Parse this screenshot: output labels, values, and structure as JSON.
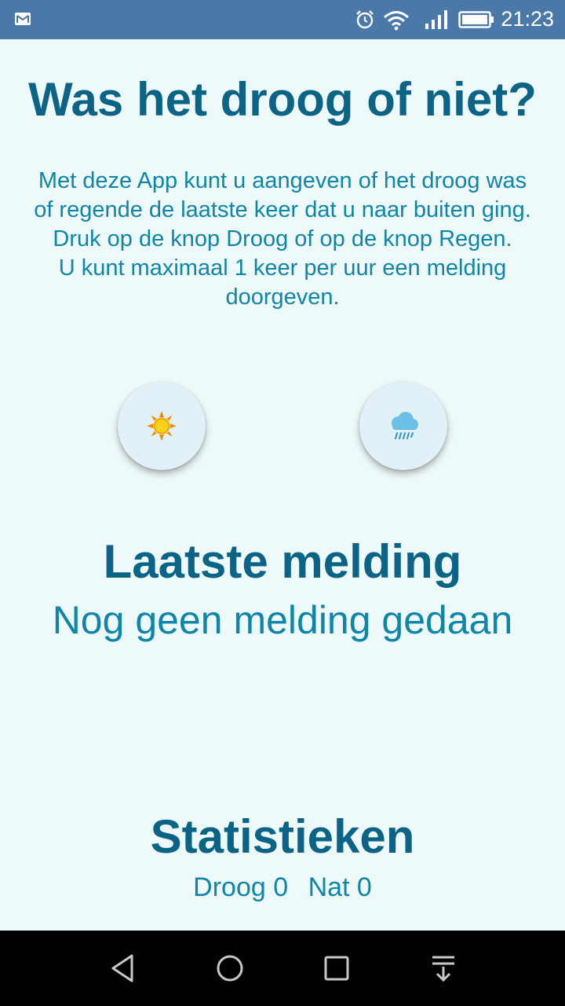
{
  "status_bar": {
    "time": "21:23",
    "icons": [
      "mail-icon",
      "alarm-icon",
      "wifi-icon",
      "signal-icon",
      "battery-icon"
    ]
  },
  "main": {
    "title": "Was het droog of niet?",
    "intro_lines": [
      "Met deze App kunt u aangeven of het droog was of regende de laatste keer dat u naar buiten ging.",
      "Druk op de knop Droog of op de knop Regen.",
      "U kunt maximaal 1 keer per uur een melding doorgeven."
    ],
    "buttons": {
      "dry_icon": "sun-icon",
      "rain_icon": "rain-cloud-icon"
    },
    "last_report": {
      "title": "Laatste melding",
      "value": "Nog geen melding gedaan"
    },
    "statistics": {
      "title": "Statistieken",
      "dry_label": "Droog 0",
      "wet_label": "Nat 0"
    }
  },
  "nav_bar": {
    "icons": [
      "back-icon",
      "home-icon",
      "recent-apps-icon",
      "notification-icon"
    ]
  },
  "colors": {
    "status_bar": "#4a78a8",
    "background": "#eef9fa",
    "heading": "#0b6485",
    "body_text": "#0e86a9",
    "button_bg": "#e2f1f7",
    "nav_bar": "#000000"
  }
}
